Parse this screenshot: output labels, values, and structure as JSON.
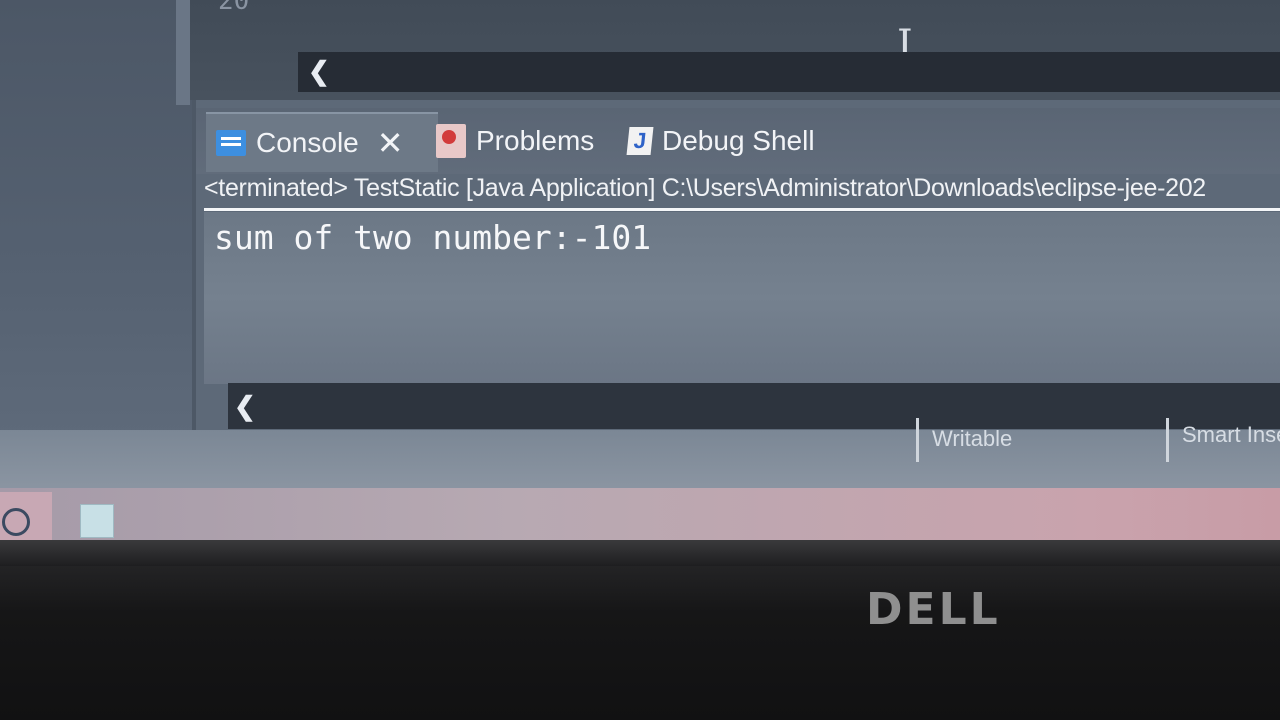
{
  "editor": {
    "line_number": "20"
  },
  "console_view": {
    "tabs": [
      {
        "label": "Console",
        "icon": "console-icon",
        "active": true
      },
      {
        "label": "Problems",
        "icon": "problems-icon",
        "active": false
      },
      {
        "label": "Debug Shell",
        "icon": "debug-shell-icon",
        "active": false
      }
    ],
    "status": "<terminated> TestStatic [Java Application] C:\\Users\\Administrator\\Downloads\\eclipse-jee-202",
    "output": "sum of two number:-101"
  },
  "status_bar": {
    "writable": "Writable",
    "insert_mode": "Smart Inse"
  },
  "bezel": {
    "brand": "DELL"
  }
}
